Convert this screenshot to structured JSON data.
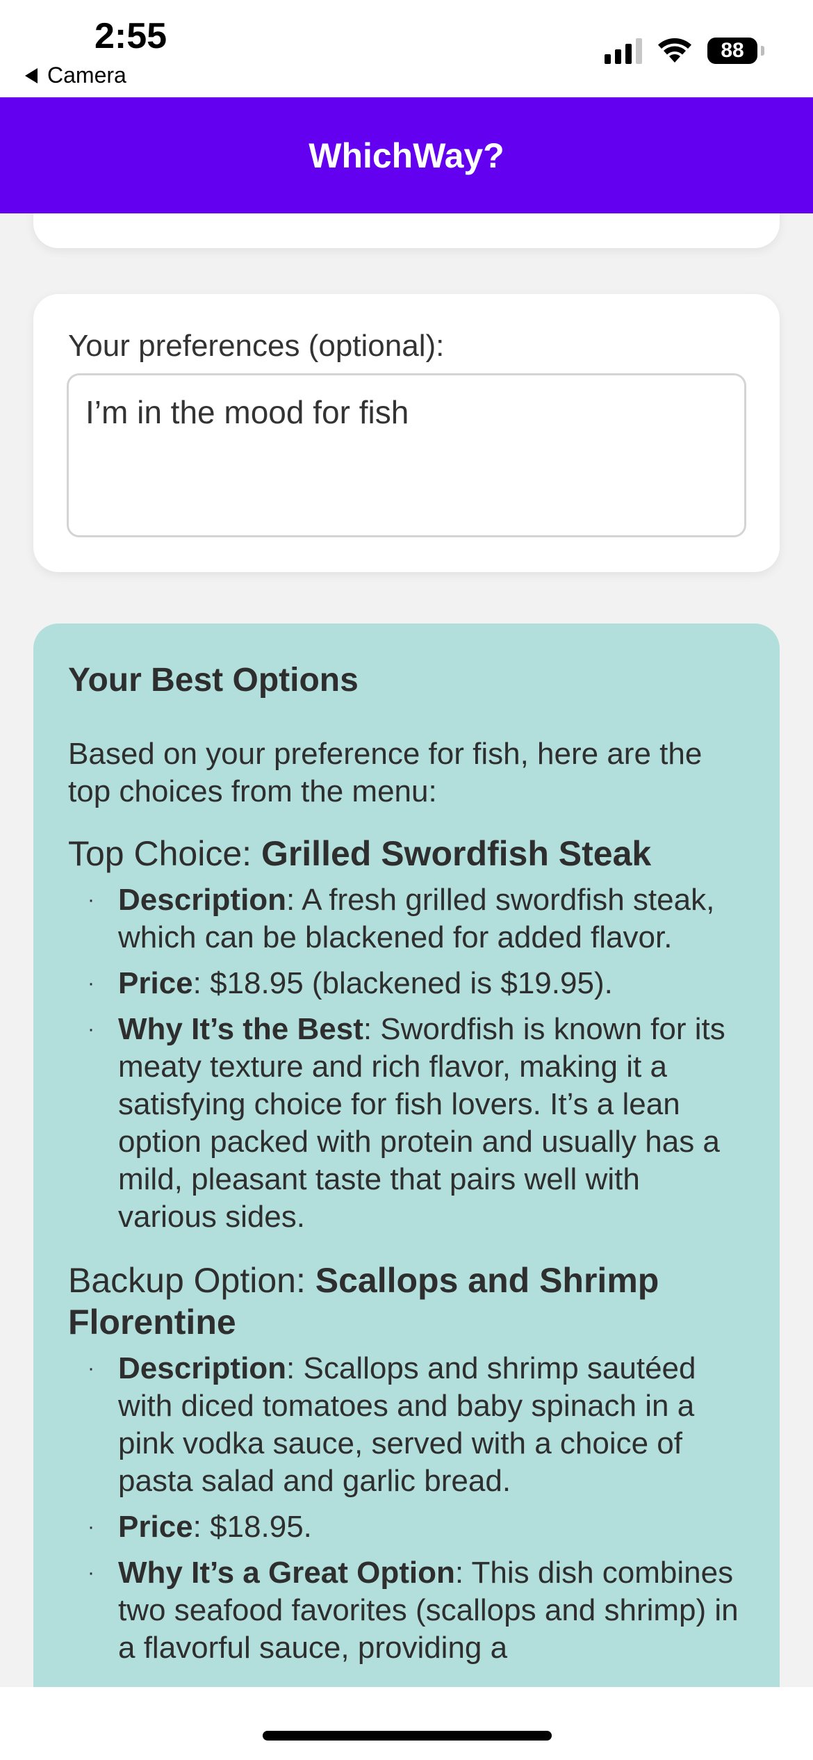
{
  "status_bar": {
    "time": "2:55",
    "back_app": "Camera",
    "battery": "88"
  },
  "header": {
    "title": "WhichWay?"
  },
  "preferences": {
    "label": "Your preferences (optional):",
    "value": "I’m in the mood for fish"
  },
  "results": {
    "title": "Your Best Options",
    "intro": "Based on your preference for fish, here are the top choices from the menu:",
    "top_choice": {
      "prefix": "Top Choice: ",
      "name": "Grilled Swordfish Steak",
      "details": [
        {
          "label": "Description",
          "text": ": A fresh grilled swordfish steak, which can be blackened for added flavor."
        },
        {
          "label": "Price",
          "text": ": $18.95 (blackened is $19.95)."
        },
        {
          "label": "Why It’s the Best",
          "text": ": Swordfish is known for its meaty texture and rich flavor, making it a satisfying choice for fish lovers. It’s a lean option packed with protein and usually has a mild, pleasant taste that pairs well with various sides."
        }
      ]
    },
    "backup_option": {
      "prefix": "Backup Option: ",
      "name": "Scallops and Shrimp Florentine",
      "details": [
        {
          "label": "Description",
          "text": ": Scallops and shrimp sautéed with diced tomatoes and baby spinach in a pink vodka sauce, served with a choice of pasta salad and garlic bread."
        },
        {
          "label": "Price",
          "text": ": $18.95."
        },
        {
          "label": "Why It’s a Great Option",
          "text": ": This dish combines two seafood favorites (scallops and shrimp) in a flavorful sauce, providing a"
        }
      ]
    },
    "bullet": "·"
  },
  "colors": {
    "header_bg": "#6300f0",
    "results_bg": "#b2dfdc",
    "page_bg": "#f2f2f3"
  }
}
